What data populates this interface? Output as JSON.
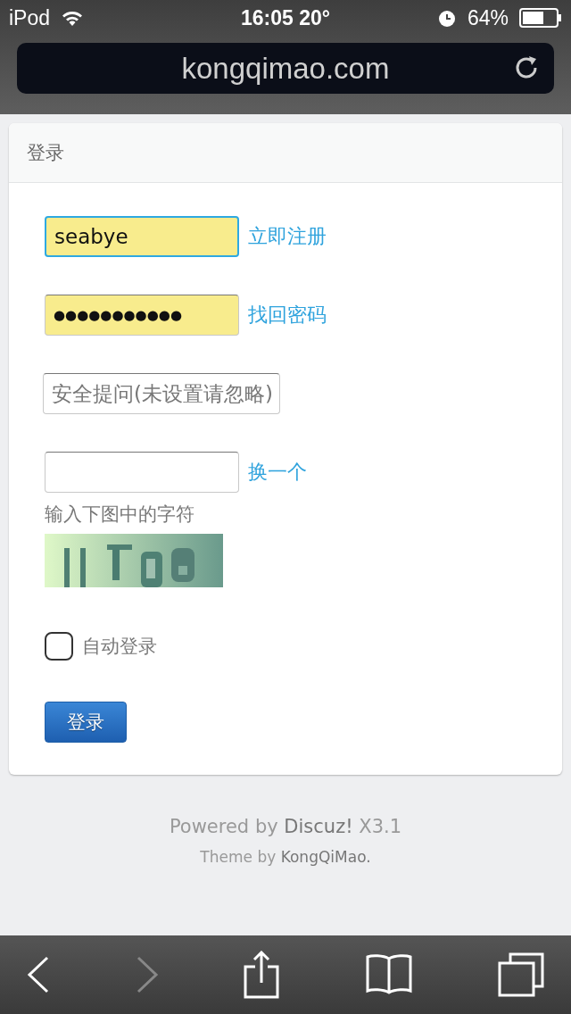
{
  "status_bar": {
    "device": "iPod",
    "time": "16:05 20°",
    "battery": "64%"
  },
  "address_bar": {
    "url": "kongqimao.com"
  },
  "login": {
    "title": "登录",
    "fields": [
      {
        "kind": "text",
        "value": "seabye",
        "focused": true,
        "autofilled": true,
        "link": "立即注册"
      },
      {
        "kind": "password",
        "value": "●●●●●●●●●●●",
        "focused": false,
        "autofilled": true,
        "link": "找回密码"
      },
      {
        "kind": "select",
        "placeholder": "安全提问(未设置请忽略)",
        "focused": false,
        "autofilled": false
      },
      {
        "kind": "captcha",
        "focused": false,
        "autofilled": false,
        "link": "换一个",
        "hint": "输入下图中的字符"
      }
    ],
    "remember": {
      "label": "自动登录",
      "checked": false
    },
    "submit": "登录"
  },
  "footer": {
    "powered_prefix": "Powered by",
    "powered_link": "Discuz!",
    "powered_suffix": "X3.1",
    "theme_prefix": "Theme by",
    "theme_link": "KongQiMao."
  },
  "toolbar": {
    "back_disabled": false,
    "forward_disabled": true
  }
}
